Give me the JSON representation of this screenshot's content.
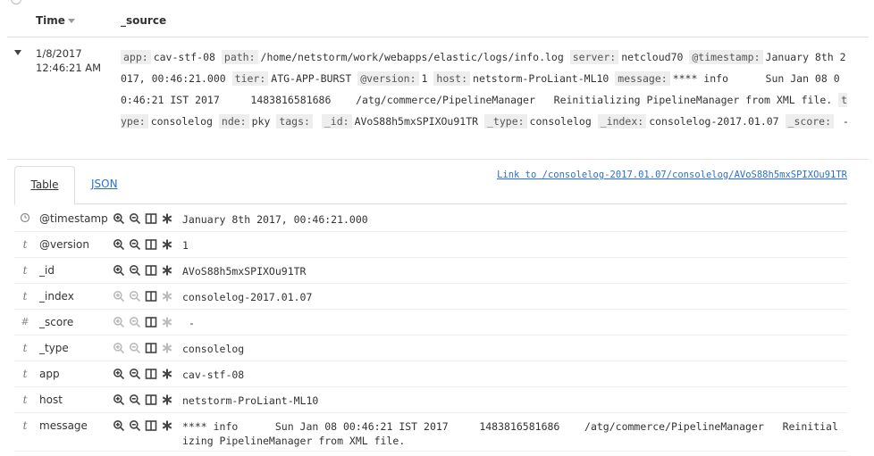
{
  "header": {
    "time_label": "Time",
    "source_label": "_source"
  },
  "doc": {
    "date": "1/8/2017",
    "time": "12:46:21 AM",
    "source": [
      {
        "k": "app:",
        "v": "cav-stf-08"
      },
      {
        "k": "path:",
        "v": "/home/netstorm/work/webapps/elastic/logs/info.log"
      },
      {
        "k": "server:",
        "v": "netcloud70"
      },
      {
        "k": "@timestamp:",
        "v": "January 8th 2017, 00:46:21.000"
      },
      {
        "k": "tier:",
        "v": "ATG-APP-BURST"
      },
      {
        "k": "@version:",
        "v": "1"
      },
      {
        "k": "host:",
        "v": "netstorm-ProLiant-ML10"
      },
      {
        "k": "message:",
        "v": "**** info      Sun Jan 08 00:46:21 IST 2017     1483816581686    /atg/commerce/PipelineManager   Reinitializing PipelineManager from XML file."
      },
      {
        "k": "type:",
        "v": "consolelog"
      },
      {
        "k": "nde:",
        "v": "pky"
      },
      {
        "k": "tags:",
        "v": ""
      },
      {
        "k": "_id:",
        "v": "AVoS88h5mxSPIXOu91TR"
      },
      {
        "k": "_type:",
        "v": "consolelog"
      },
      {
        "k": "_index:",
        "v": "consolelog-2017.01.07"
      },
      {
        "k": "_score:",
        "v": " -"
      }
    ]
  },
  "tabs": {
    "table_label": "Table",
    "json_label": "JSON"
  },
  "link_label": "Link to /consolelog-2017.01.07/consolelog/AVoS88h5mxSPIXOu91TR",
  "fields": [
    {
      "type_icon": "clock",
      "name": "@timestamp",
      "value": "January 8th 2017, 00:46:21.000",
      "active": true
    },
    {
      "type_icon": "t",
      "name": "@version",
      "value": "1",
      "active": true
    },
    {
      "type_icon": "t",
      "name": "_id",
      "value": "AVoS88h5mxSPIXOu91TR",
      "active": true
    },
    {
      "type_icon": "t",
      "name": "_index",
      "value": "consolelog-2017.01.07",
      "active": false
    },
    {
      "type_icon": "#",
      "name": "_score",
      "value": " -",
      "active": false
    },
    {
      "type_icon": "t",
      "name": "_type",
      "value": "consolelog",
      "active": false
    },
    {
      "type_icon": "t",
      "name": "app",
      "value": "cav-stf-08",
      "active": true
    },
    {
      "type_icon": "t",
      "name": "host",
      "value": "netstorm-ProLiant-ML10",
      "active": true
    },
    {
      "type_icon": "t",
      "name": "message",
      "value": "**** info      Sun Jan 08 00:46:21 IST 2017     1483816581686    /atg/commerce/PipelineManager   Reinitializing PipelineManager from XML file.",
      "active": true
    }
  ],
  "colors": {
    "link": "#2a6fd6",
    "icon_active": "#444444",
    "icon_inactive": "#bbbbbb"
  }
}
